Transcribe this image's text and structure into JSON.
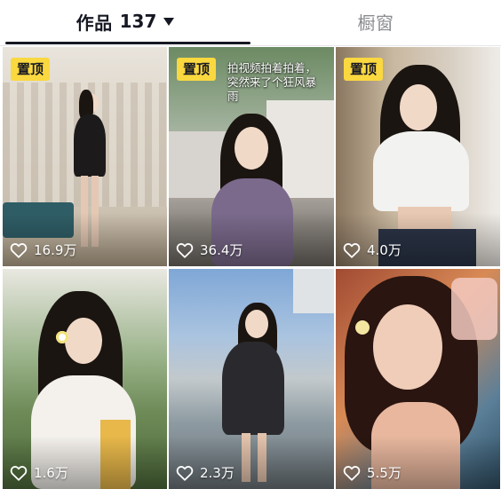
{
  "tabs": {
    "works_label": "作品",
    "works_count": "137",
    "window_label": "橱窗"
  },
  "videos": [
    {
      "pinned": "置顶",
      "likes": "16.9万"
    },
    {
      "pinned": "置顶",
      "caption": "拍视频拍着拍着，突然来了个狂风暴雨",
      "likes": "36.4万"
    },
    {
      "pinned": "置顶",
      "likes": "4.0万"
    },
    {
      "likes": "1.6万"
    },
    {
      "likes": "2.3万"
    },
    {
      "likes": "5.5万"
    }
  ],
  "colors": {
    "pinned_badge": "#fad83f",
    "active_tab_text": "#161823",
    "inactive_tab_text": "#8a8b91"
  },
  "icons": {
    "like": "heart-outline-icon",
    "dropdown": "caret-down-icon"
  }
}
